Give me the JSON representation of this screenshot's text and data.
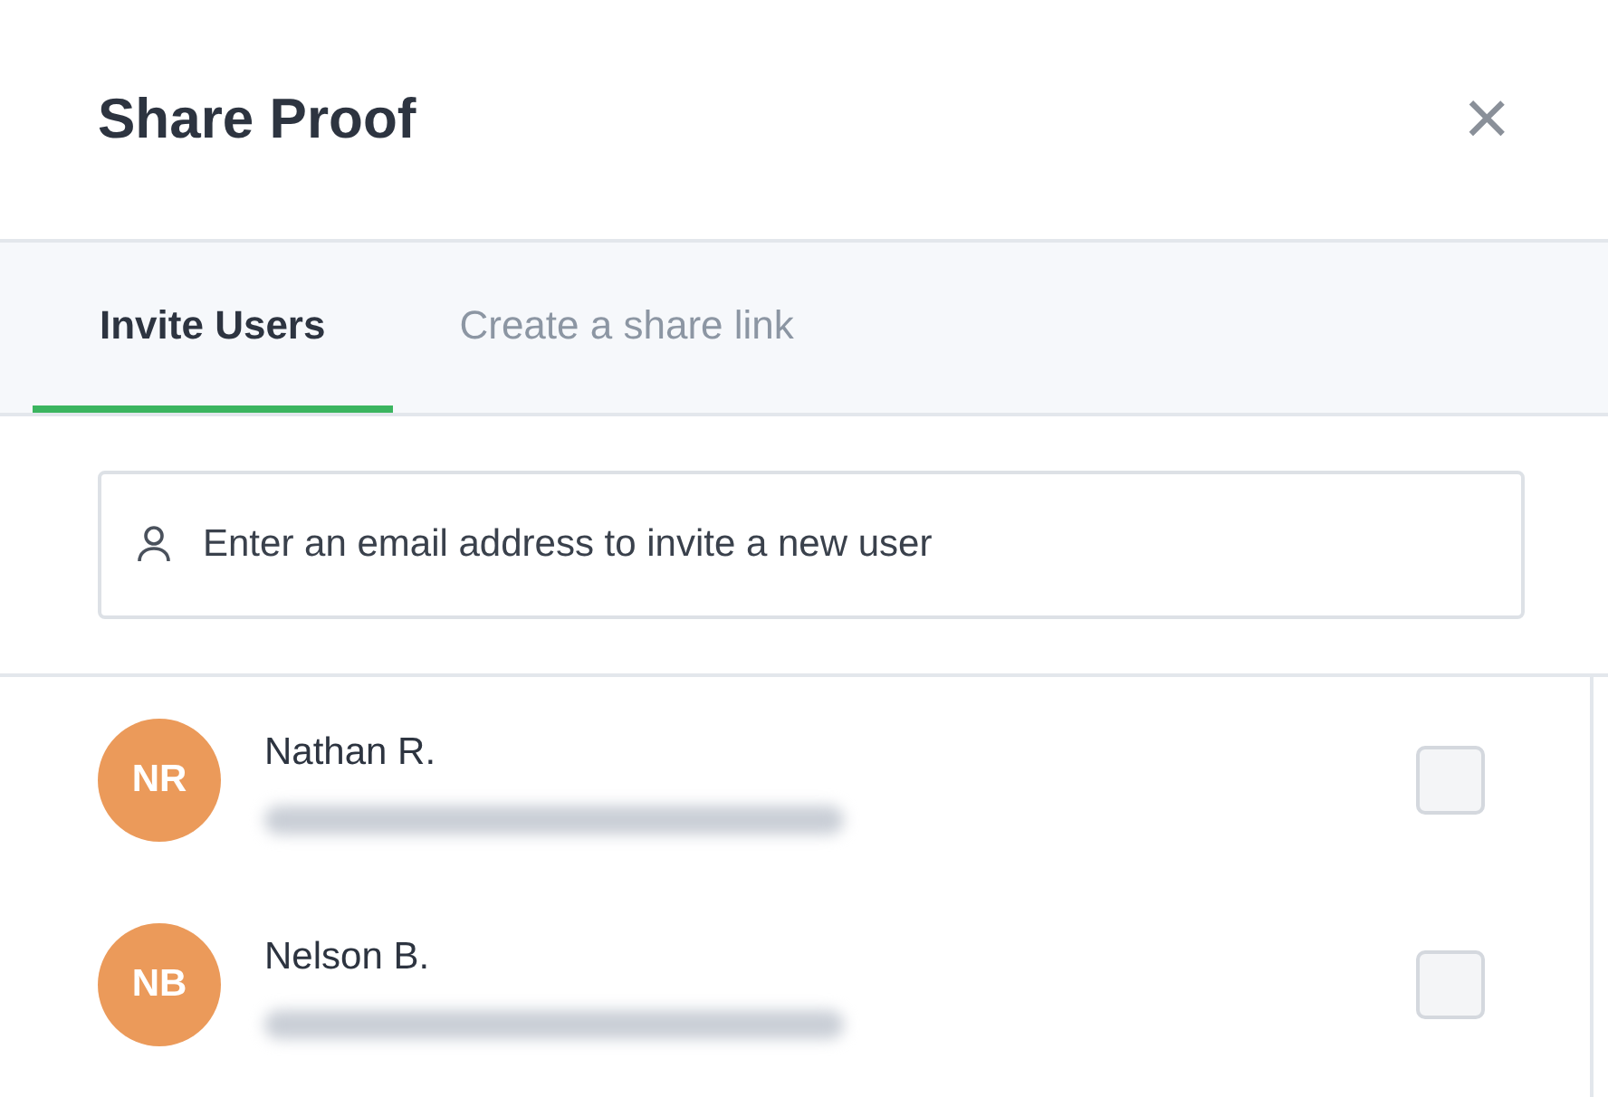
{
  "dialog": {
    "title": "Share Proof",
    "close": "×"
  },
  "tabs": [
    {
      "label": "Invite Users",
      "selected": true
    },
    {
      "label": "Create a share link",
      "selected": false
    }
  ],
  "invite_field": {
    "placeholder": "Enter an email address to invite a new user"
  },
  "users": [
    {
      "initials": "NR",
      "name": "Nathan R.",
      "color": "#eb9a5a",
      "email_blurred": true,
      "checked": false
    },
    {
      "initials": "NB",
      "name": "Nelson B.",
      "color": "#eb9a5a",
      "email_blurred": true,
      "checked": false
    }
  ]
}
